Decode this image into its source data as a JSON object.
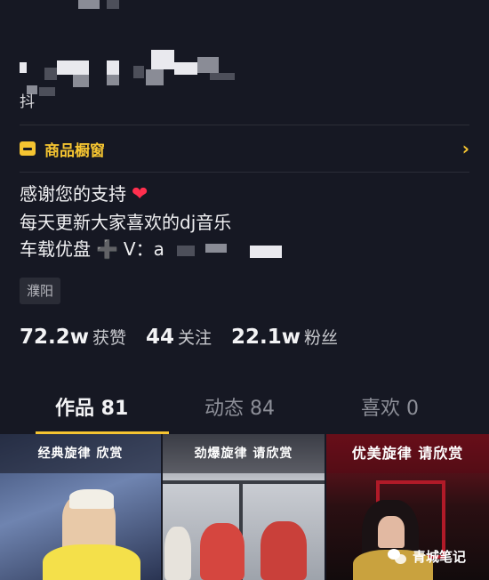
{
  "profile": {
    "douyin_id_prefix": "抖",
    "shop_window": {
      "label": "商品橱窗",
      "chevron": "›"
    },
    "bio": {
      "line1": "感谢您的支持",
      "heart": "❤",
      "line2": "每天更新大家喜欢的dj音乐",
      "line3_label": "车载优盘",
      "line3_plus": "➕",
      "line3_contact": "V：a"
    },
    "location": "濮阳",
    "stats": [
      {
        "value": "72.2w",
        "label": "获赞"
      },
      {
        "value": "44",
        "label": "关注"
      },
      {
        "value": "22.1w",
        "label": "粉丝"
      }
    ]
  },
  "tabs": [
    {
      "label": "作品 81",
      "active": true
    },
    {
      "label": "动态 84",
      "active": false
    },
    {
      "label": "喜欢 0",
      "active": false
    }
  ],
  "videos": [
    {
      "caption": "经典旋律 欣赏"
    },
    {
      "caption": "劲爆旋律 请欣赏"
    },
    {
      "caption": "优美旋律 请欣赏"
    }
  ],
  "watermark": {
    "text": "青城笔记",
    "icon": "wechat-icon"
  },
  "colors": {
    "background": "#161823",
    "accent": "#f5c431",
    "heart": "#ff2f4e"
  }
}
